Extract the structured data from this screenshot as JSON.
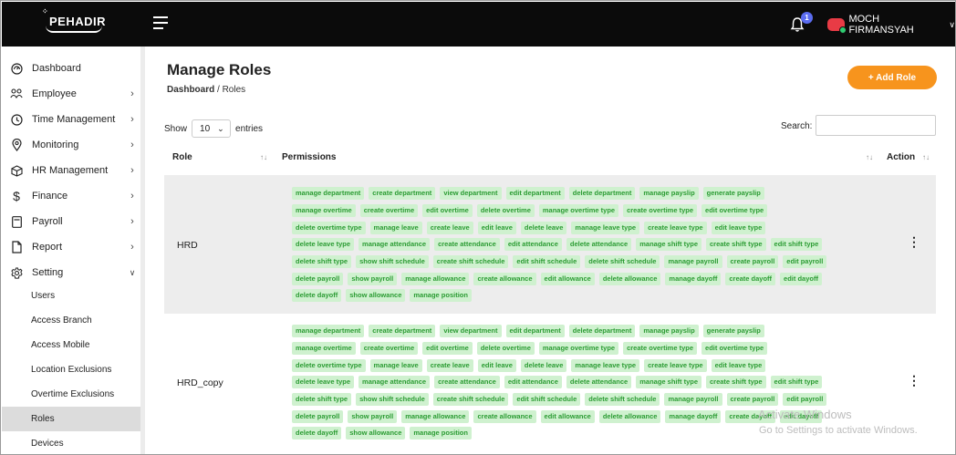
{
  "header": {
    "logo_text": "PEHADIR",
    "notification_count": "1",
    "user_name": "MOCH FIRMANSYAH"
  },
  "sidebar": {
    "items": [
      {
        "label": "Dashboard",
        "icon": "dashboard-gauge-icon",
        "has_arrow": false
      },
      {
        "label": "Employee",
        "icon": "people-icon",
        "has_arrow": true
      },
      {
        "label": "Time Management",
        "icon": "clock-icon",
        "has_arrow": true
      },
      {
        "label": "Monitoring",
        "icon": "location-pin-icon",
        "has_arrow": true
      },
      {
        "label": "HR Management",
        "icon": "box-icon",
        "has_arrow": true
      },
      {
        "label": "Finance",
        "icon": "dollar-icon",
        "has_arrow": true
      },
      {
        "label": "Payroll",
        "icon": "calculator-icon",
        "has_arrow": true
      },
      {
        "label": "Report",
        "icon": "document-icon",
        "has_arrow": true
      },
      {
        "label": "Setting",
        "icon": "gear-icon",
        "has_arrow": true,
        "expanded": true
      }
    ],
    "sub_items": [
      {
        "label": "Users"
      },
      {
        "label": "Access Branch"
      },
      {
        "label": "Access Mobile"
      },
      {
        "label": "Location Exclusions"
      },
      {
        "label": "Overtime Exclusions"
      },
      {
        "label": "Roles",
        "active": true
      },
      {
        "label": "Devices"
      }
    ]
  },
  "main": {
    "title": "Manage Roles",
    "breadcrumb_root": "Dashboard",
    "breadcrumb_sep": "/",
    "breadcrumb_current": "Roles",
    "add_button": "+ Add Role",
    "show_label": "Show",
    "entries_value": "10",
    "entries_label": "entries",
    "search_label": "Search:",
    "search_value": ""
  },
  "table": {
    "headers": {
      "role": "Role",
      "permissions": "Permissions",
      "action": "Action"
    },
    "sort_glyph": "↑↓",
    "rows": [
      {
        "role": "HRD",
        "permission_lines": [
          [
            "manage department",
            "create department",
            "view department",
            "edit department",
            "delete department",
            "manage payslip",
            "generate payslip"
          ],
          [
            "manage overtime",
            "create overtime",
            "edit overtime",
            "delete overtime",
            "manage overtime type",
            "create overtime type",
            "edit overtime type"
          ],
          [
            "delete overtime type",
            "manage leave",
            "create leave",
            "edit leave",
            "delete leave",
            "manage leave type",
            "create leave type",
            "edit leave type"
          ],
          [
            "delete leave type",
            "manage attendance",
            "create attendance",
            "edit attendance",
            "delete attendance",
            "manage shift type",
            "create shift type",
            "edit shift type"
          ],
          [
            "delete shift type",
            "show shift schedule",
            "create shift schedule",
            "edit shift schedule",
            "delete shift schedule",
            "manage payroll",
            "create payroll",
            "edit payroll"
          ],
          [
            "delete payroll",
            "show payroll",
            "manage allowance",
            "create allowance",
            "edit allowance",
            "delete allowance",
            "manage dayoff",
            "create dayoff",
            "edit dayoff"
          ],
          [
            "delete dayoff",
            "show allowance",
            "manage position"
          ]
        ]
      },
      {
        "role": "HRD_copy",
        "permission_lines": [
          [
            "manage department",
            "create department",
            "view department",
            "edit department",
            "delete department",
            "manage payslip",
            "generate payslip"
          ],
          [
            "manage overtime",
            "create overtime",
            "edit overtime",
            "delete overtime",
            "manage overtime type",
            "create overtime type",
            "edit overtime type"
          ],
          [
            "delete overtime type",
            "manage leave",
            "create leave",
            "edit leave",
            "delete leave",
            "manage leave type",
            "create leave type",
            "edit leave type"
          ],
          [
            "delete leave type",
            "manage attendance",
            "create attendance",
            "edit attendance",
            "delete attendance",
            "manage shift type",
            "create shift type",
            "edit shift type"
          ],
          [
            "delete shift type",
            "show shift schedule",
            "create shift schedule",
            "edit shift schedule",
            "delete shift schedule",
            "manage payroll",
            "create payroll",
            "edit payroll"
          ],
          [
            "delete payroll",
            "show payroll",
            "manage allowance",
            "create allowance",
            "edit allowance",
            "delete allowance",
            "manage dayoff",
            "create dayoff",
            "edit dayoff"
          ],
          [
            "delete dayoff",
            "show allowance",
            "manage position"
          ]
        ]
      }
    ]
  },
  "watermark": {
    "line1": "Activate Windows",
    "line2": "Go to Settings to activate Windows."
  },
  "colors": {
    "topbar": "#0b0b0b",
    "accent": "#f7941d",
    "tag_bg": "#cff1cf",
    "tag_text": "#2b9c33",
    "badge": "#5b6cf0"
  }
}
